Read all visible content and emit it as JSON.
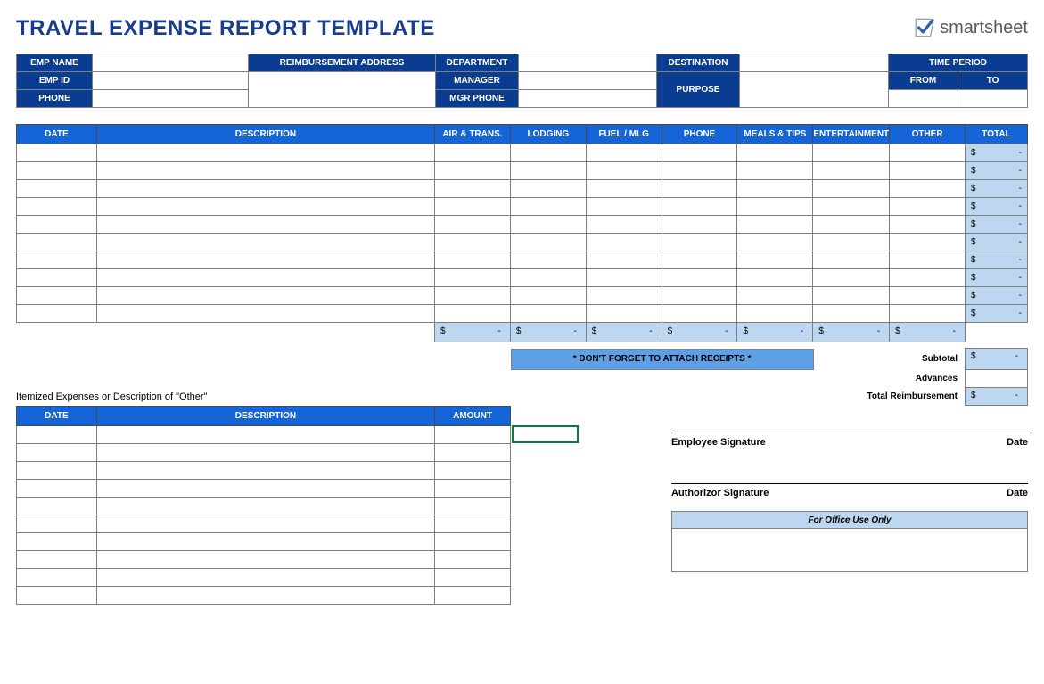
{
  "title": "TRAVEL EXPENSE REPORT TEMPLATE",
  "brand": "smartsheet",
  "meta": {
    "emp_name": "EMP NAME",
    "reimb_addr": "REIMBURSEMENT ADDRESS",
    "department": "DEPARTMENT",
    "destination": "DESTINATION",
    "time_period": "TIME PERIOD",
    "emp_id": "EMP ID",
    "manager": "MANAGER",
    "purpose": "PURPOSE",
    "from": "FROM",
    "to": "TO",
    "phone": "PHONE",
    "mgr_phone": "MGR PHONE"
  },
  "exp_headers": {
    "date": "DATE",
    "description": "DESCRIPTION",
    "air": "AIR & TRANS.",
    "lodging": "LODGING",
    "fuel": "FUEL / MLG",
    "phone": "PHONE",
    "meals": "MEALS & TIPS",
    "entertainment": "ENTERTAINMENT",
    "other": "OTHER",
    "total": "TOTAL"
  },
  "exp_rows": 10,
  "total_cell": {
    "dollar": "$",
    "dash": "-"
  },
  "receipts_note": "* DON'T FORGET TO ATTACH RECEIPTS *",
  "summary": {
    "subtotal": "Subtotal",
    "advances": "Advances",
    "total_reimb": "Total Reimbursement"
  },
  "itemized_label": "Itemized Expenses or Description of \"Other\"",
  "item_headers": {
    "date": "DATE",
    "description": "DESCRIPTION",
    "amount": "AMOUNT"
  },
  "item_rows": 10,
  "signatures": {
    "employee": "Employee Signature",
    "authorizor": "Authorizor Signature",
    "date": "Date"
  },
  "office_use": "For Office Use Only"
}
